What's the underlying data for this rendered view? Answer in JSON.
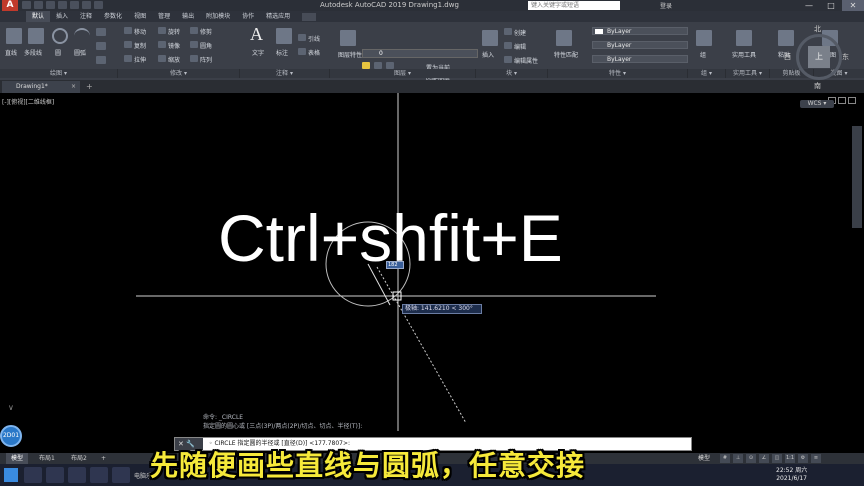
{
  "window": {
    "app_logo": "A",
    "title": "Autodesk AutoCAD 2019   Drawing1.dwg",
    "search_placeholder": "键入关键字或短语",
    "login": "登录",
    "minimize": "—",
    "maximize": "□",
    "close": "✕"
  },
  "menu": {
    "tabs": [
      "默认",
      "插入",
      "注释",
      "参数化",
      "视图",
      "管理",
      "输出",
      "附加模块",
      "协作",
      "精选应用"
    ]
  },
  "ribbon": {
    "tools": {
      "line": "直线",
      "polyline": "多段线",
      "circle": "圆",
      "arc": "圆弧",
      "move": "移动",
      "rotate": "旋转",
      "trim": "修剪",
      "copy": "复制",
      "mirror": "镜像",
      "fillet": "圆角",
      "stretch": "拉伸",
      "scale": "缩放",
      "array": "阵列",
      "text": "文字",
      "dimension": "标注",
      "leader": "引线",
      "table": "表格",
      "layer_props": "图层特性",
      "make_current": "置为当前",
      "match_layer": "匹配图层",
      "insert": "插入",
      "create": "创建",
      "edit": "编辑",
      "edit_attr": "编辑属性",
      "match_props": "特性匹配",
      "group": "组",
      "utilities": "实用工具",
      "clipboard": "剪贴板",
      "view": "视图",
      "paste": "粘贴"
    },
    "layer_value": "0",
    "prop_color": "ByLayer",
    "prop_linetype": "ByLayer",
    "prop_lineweight": "ByLayer",
    "panels": [
      "绘图 ▾",
      "修改 ▾",
      "注释 ▾",
      "图层 ▾",
      "块 ▾",
      "特性 ▾",
      "组 ▾",
      "实用工具 ▾",
      "剪贴板",
      "视图 ▾"
    ]
  },
  "filetab": {
    "label": "Drawing1*",
    "close": "×",
    "new": "+"
  },
  "canvas": {
    "viewport_label": "[-][俯视][二维线框]",
    "overlay_text": "Ctrl+shfit+E",
    "dyn_input": "极轴: 141.6210 < 300°",
    "dyn_small": "182",
    "cmd_history": [
      "命令: _CIRCLE",
      "指定圆的圆心或 [三点(3P)/两点(2P)/切点、切点、半径(T)]:"
    ],
    "ucs_label": "2D01"
  },
  "viewcube": {
    "north": "北",
    "south": "南",
    "west": "西",
    "east": "东",
    "top": "上",
    "wcs": "WCS ▾"
  },
  "commandline": {
    "buttons": "✕ 🔧",
    "prompt": "◦ CIRCLE 指定圆的半径或 [直径(D)] <177.7807>:"
  },
  "layouts": {
    "tabs": [
      "模型",
      "布局1",
      "布局2"
    ],
    "add": "+",
    "model_btn": "模型",
    "status_icons": [
      "#",
      "⊥",
      "⊙",
      "∠",
      "◫",
      "1:1",
      "⚙",
      "≡"
    ]
  },
  "taskbar": {
    "item_label": "电脑乐",
    "time": "22:52 周六",
    "date": "2021/6/17"
  },
  "subtitle": "先随便画些直线与圆弧，任意交接"
}
